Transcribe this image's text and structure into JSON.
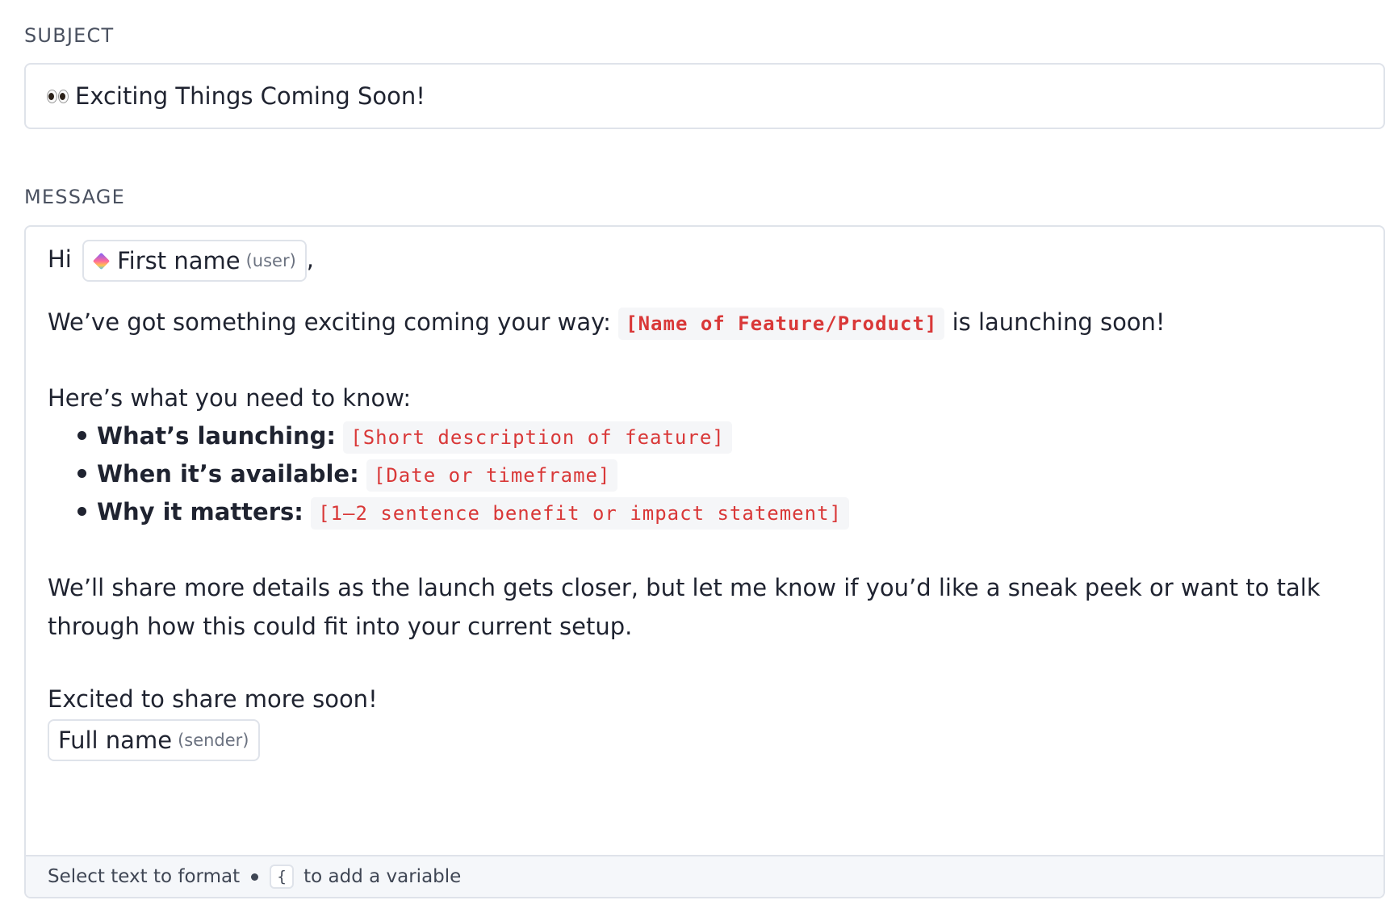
{
  "subject": {
    "label": "SUBJECT",
    "value": "Exciting Things Coming Soon!",
    "emoji": "eyes-icon"
  },
  "message": {
    "label": "MESSAGE",
    "greeting": "Hi",
    "greeting_suffix": ",",
    "first_name_var": {
      "label": "First name",
      "hint": "(user)"
    },
    "intro_before": "We’ve got something exciting coming your way:",
    "intro_placeholder": "[Name of Feature/Product]",
    "intro_after": "is launching soon!",
    "know_heading": "Here’s what you need to know:",
    "bullets": [
      {
        "term": "What’s launching:",
        "placeholder": "[Short description of feature]"
      },
      {
        "term": "When it’s available:",
        "placeholder": "[Date or timeframe]"
      },
      {
        "term": "Why it matters:",
        "placeholder": "[1–2 sentence benefit or impact statement]"
      }
    ],
    "closing_paragraph": "We’ll share more details as the launch gets closer, but let me know if you’d like a sneak peek or want to talk through how this could fit into your current setup.",
    "signoff": "Excited to share more soon!",
    "sender_var": {
      "label": "Full name",
      "hint": "(sender)"
    }
  },
  "footer": {
    "format_hint": "Select text to format",
    "key": "{",
    "variable_hint": "to add a variable"
  }
}
